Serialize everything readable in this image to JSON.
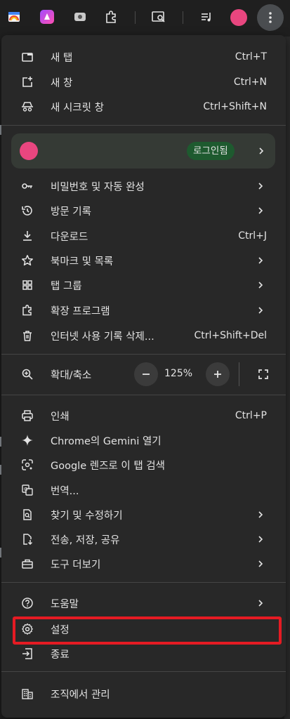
{
  "menu": {
    "new_tab": {
      "label": "새 탭",
      "shortcut": "Ctrl+T"
    },
    "new_window": {
      "label": "새 창",
      "shortcut": "Ctrl+N"
    },
    "incognito": {
      "label": "새 시크릿 창",
      "shortcut": "Ctrl+Shift+N"
    },
    "profile": {
      "badge": "로그인됨"
    },
    "passwords": {
      "label": "비밀번호 및 자동 완성"
    },
    "history": {
      "label": "방문 기록"
    },
    "downloads": {
      "label": "다운로드",
      "shortcut": "Ctrl+J"
    },
    "bookmarks": {
      "label": "북마크 및 목록"
    },
    "tab_groups": {
      "label": "탭 그룹"
    },
    "extensions": {
      "label": "확장 프로그램"
    },
    "clear_data": {
      "label": "인터넷 사용 기록 삭제...",
      "shortcut": "Ctrl+Shift+Del"
    },
    "zoom": {
      "label": "확대/축소",
      "value": "125%"
    },
    "print": {
      "label": "인쇄",
      "shortcut": "Ctrl+P"
    },
    "gemini": {
      "label": "Chrome의 Gemini 열기"
    },
    "lens": {
      "label": "Google 렌즈로 이 탭 검색"
    },
    "translate": {
      "label": "번역..."
    },
    "find_edit": {
      "label": "찾기 및 수정하기"
    },
    "cast_save_share": {
      "label": "전송, 저장, 공유"
    },
    "more_tools": {
      "label": "도구 더보기"
    },
    "help": {
      "label": "도움말"
    },
    "settings": {
      "label": "설정"
    },
    "exit": {
      "label": "종료"
    },
    "managed": {
      "label": "조직에서 관리"
    }
  },
  "colors": {
    "menu_bg": "#282828",
    "profile_bg": "#353a35",
    "badge_bg": "#1e5a2f",
    "avatar": "#e8467f",
    "highlight": "#e51b23"
  }
}
